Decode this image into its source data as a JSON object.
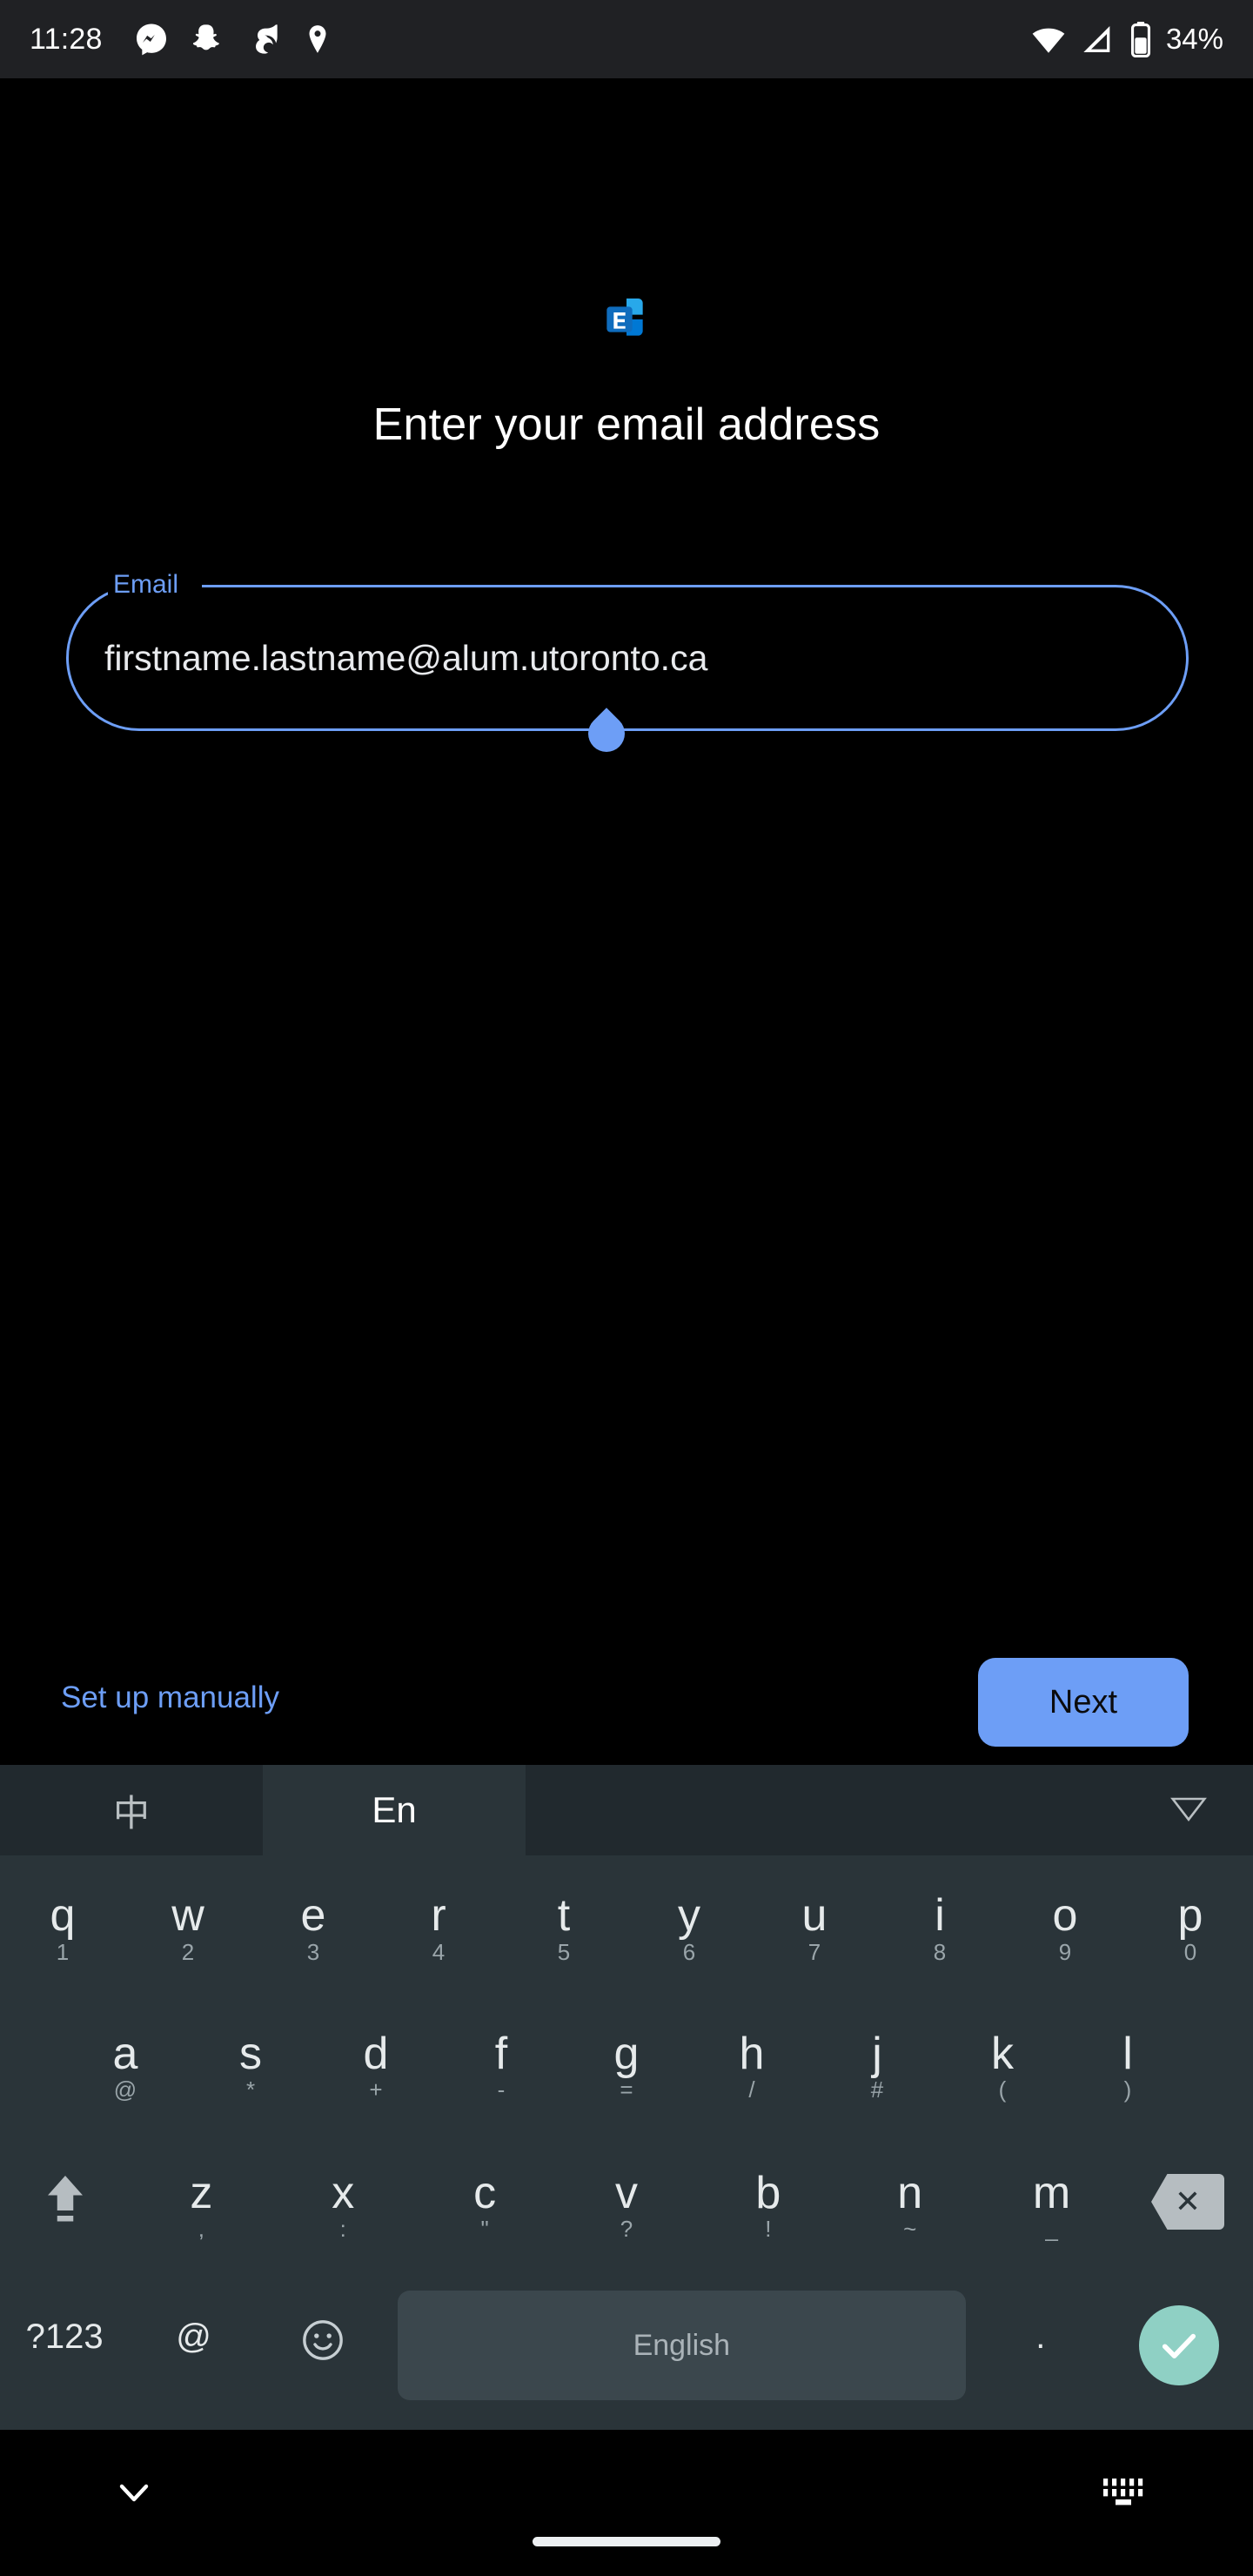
{
  "status_bar": {
    "time": "11:28",
    "icons": [
      "messenger-icon",
      "snapchat-icon",
      "app-icon",
      "location-pin-icon"
    ],
    "wifi": "wifi-icon",
    "signal": "cell-signal-icon",
    "battery_icon": "battery-icon",
    "battery_text": "34%"
  },
  "app": {
    "logo": "microsoft-exchange-logo",
    "title": "Enter your email address"
  },
  "email_field": {
    "label": "Email",
    "value": "firstname.lastname@alum.utoronto.ca",
    "placeholder": "Email",
    "accent_color": "#6d9ef6",
    "cursor_handle": "text-cursor-handle"
  },
  "actions": {
    "manual_link": "Set up manually",
    "next_label": "Next",
    "next_bg": "#6d9ef6",
    "next_fg": "#0b0b0d"
  },
  "keyboard": {
    "toolbar": {
      "lang_zh": "中",
      "lang_en": "En",
      "collapse": "collapse-icon"
    },
    "rows": [
      {
        "keys": [
          {
            "main": "q",
            "hint": "1"
          },
          {
            "main": "w",
            "hint": "2"
          },
          {
            "main": "e",
            "hint": "3"
          },
          {
            "main": "r",
            "hint": "4"
          },
          {
            "main": "t",
            "hint": "5"
          },
          {
            "main": "y",
            "hint": "6"
          },
          {
            "main": "u",
            "hint": "7"
          },
          {
            "main": "i",
            "hint": "8"
          },
          {
            "main": "o",
            "hint": "9"
          },
          {
            "main": "p",
            "hint": "0"
          }
        ]
      },
      {
        "keys": [
          {
            "main": "a",
            "hint": "@"
          },
          {
            "main": "s",
            "hint": "*"
          },
          {
            "main": "d",
            "hint": "+"
          },
          {
            "main": "f",
            "hint": "-"
          },
          {
            "main": "g",
            "hint": "="
          },
          {
            "main": "h",
            "hint": "/"
          },
          {
            "main": "j",
            "hint": "#"
          },
          {
            "main": "k",
            "hint": "("
          },
          {
            "main": "l",
            "hint": ")"
          }
        ]
      },
      {
        "shift": "shift-key",
        "keys": [
          {
            "main": "z",
            "hint": ","
          },
          {
            "main": "x",
            "hint": ":"
          },
          {
            "main": "c",
            "hint": "\""
          },
          {
            "main": "v",
            "hint": "?"
          },
          {
            "main": "b",
            "hint": "!"
          },
          {
            "main": "n",
            "hint": "~"
          },
          {
            "main": "m",
            "hint": "_"
          }
        ],
        "backspace": "backspace-key"
      }
    ],
    "bottom_row": {
      "symbols": "?123",
      "at": "@",
      "emoji": "emoji-key",
      "space": "English",
      "period": ".",
      "enter": "enter-key"
    }
  },
  "nav_bar": {
    "back": "hide-keyboard-chevron",
    "home": "home-indicator",
    "keyboard_switch": "keyboard-switch-icon"
  }
}
